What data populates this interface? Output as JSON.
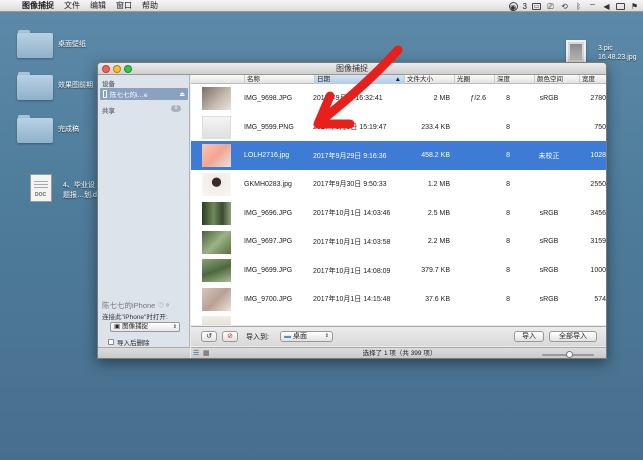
{
  "menubar": {
    "app_name": "图像捕捉",
    "items": [
      "文件",
      "编辑",
      "窗口",
      "帮助"
    ],
    "status_count": "3"
  },
  "desktop": {
    "folders": [
      {
        "label": "桌面壁纸"
      },
      {
        "label": "效果图前期"
      },
      {
        "label": "完成稿"
      }
    ],
    "doc": {
      "label_line1": "4、毕业设",
      "label_line2": "题报…划.doc",
      "type_tag": "DOC"
    },
    "pic": {
      "label_line1": "3.pic",
      "label_line2": "16.48.23.jpg"
    }
  },
  "window": {
    "title": "图像捕捉",
    "sidebar": {
      "devices_heading": "设备",
      "device_name": "陈七七的i…e",
      "shared_heading": "共享",
      "shared_count": "0",
      "connected_device_label": "陈七七的iPhone",
      "connect_prompt": "连接此\"iPhone\"时打开:",
      "open_with_app": "图像捕捉",
      "delete_after_import": "导入后删除"
    },
    "columns": [
      "名称",
      "日期",
      "文件大小",
      "光圈",
      "深度",
      "颜色空间",
      "宽度"
    ],
    "rows": [
      {
        "name": "IMG_9698.JPG",
        "date": "2017年9月日 16:32:41",
        "size": "2 MB",
        "aperture": "ƒ/2.6",
        "depth": "8",
        "colorspace": "sRGB",
        "width": "2780"
      },
      {
        "name": "IMG_9599.PNG",
        "date": "2017年9月9日 15:19:47",
        "size": "233.4 KB",
        "aperture": "",
        "depth": "8",
        "colorspace": "",
        "width": "750"
      },
      {
        "name": "LOLH2716.jpg",
        "date": "2017年9月29日 9:16:36",
        "size": "458.2 KB",
        "aperture": "",
        "depth": "8",
        "colorspace": "未校正",
        "width": "1028"
      },
      {
        "name": "GKMH0283.jpg",
        "date": "2017年9月30日 9:50:33",
        "size": "1.2 MB",
        "aperture": "",
        "depth": "8",
        "colorspace": "",
        "width": "2550"
      },
      {
        "name": "IMG_9696.JPG",
        "date": "2017年10月1日 14:03:46",
        "size": "2.5 MB",
        "aperture": "",
        "depth": "8",
        "colorspace": "sRGB",
        "width": "3456"
      },
      {
        "name": "IMG_9697.JPG",
        "date": "2017年10月1日 14:03:58",
        "size": "2.2 MB",
        "aperture": "",
        "depth": "8",
        "colorspace": "sRGB",
        "width": "3159"
      },
      {
        "name": "IMG_9699.JPG",
        "date": "2017年10月1日 14:08:09",
        "size": "379.7 KB",
        "aperture": "",
        "depth": "8",
        "colorspace": "sRGB",
        "width": "1000"
      },
      {
        "name": "IMG_9700.JPG",
        "date": "2017年10月1日 14:15:48",
        "size": "37.6 KB",
        "aperture": "",
        "depth": "8",
        "colorspace": "sRGB",
        "width": "574"
      }
    ],
    "selected_row": 2,
    "import_bar": {
      "rotate_symbol": "↺",
      "delete_symbol": "⊘",
      "import_to_label": "导入到:",
      "destination": "桌面",
      "import_button": "导入",
      "import_all_button": "全部导入"
    },
    "status_text": "选择了 1 项（共 399 项）"
  },
  "colors": {
    "selection": "#3d7bd5",
    "annotation_arrow": "#e8201c"
  }
}
